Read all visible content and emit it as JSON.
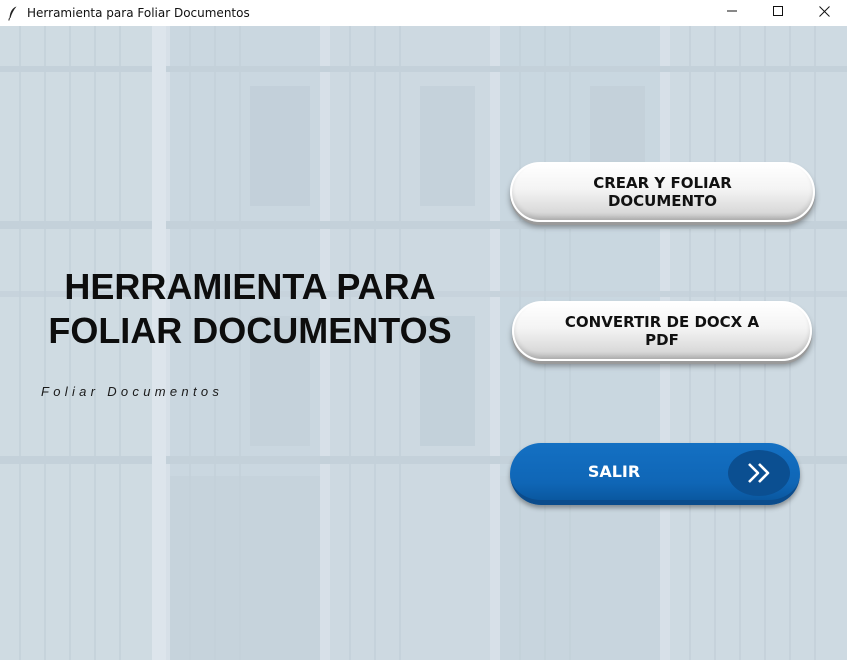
{
  "window": {
    "title": "Herramienta para Foliar Documentos",
    "icon": "feather-icon",
    "controls": [
      "minimize-icon",
      "maximize-icon",
      "close-icon"
    ]
  },
  "main": {
    "title": "HERRAMIENTA PARA\nFOLIAR DOCUMENTOS",
    "subtitle": "Foliar Documentos"
  },
  "buttons": {
    "create_label": "CREAR Y FOLIAR DOCUMENTO",
    "convert_label": "CONVERTIR DE DOCX A PDF",
    "exit_label": "SALIR",
    "exit_icon": "double-chevron-right-icon"
  },
  "colors": {
    "exit_button": "#1470c3",
    "exit_circle": "#0b4f91",
    "background_tint": "#c4d2dc"
  }
}
